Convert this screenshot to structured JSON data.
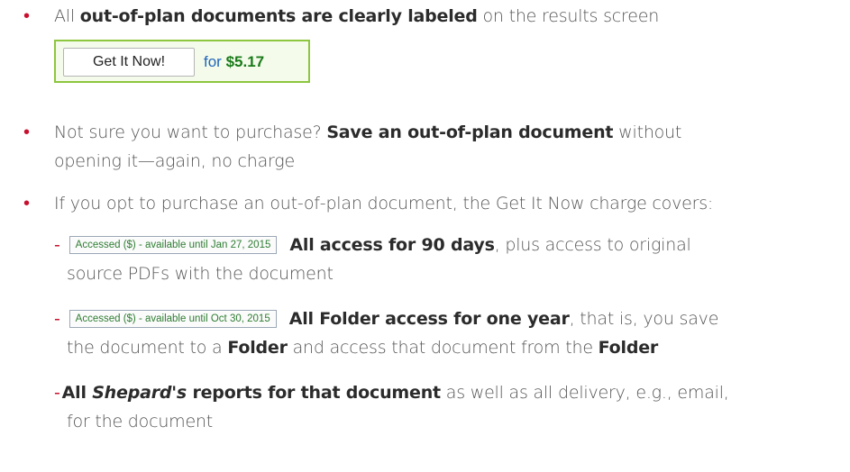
{
  "bullets": [
    {
      "pre": "All ",
      "bold": "out-of-plan documents are clearly labeled",
      "post": " on the results screen"
    },
    {
      "pre": "Not sure you want to purchase? ",
      "bold": "Save an out-of-plan document",
      "post": " without",
      "line2": "opening it—again, no charge"
    },
    {
      "text": "If you opt to purchase an out-of-plan document, the Get It Now charge covers:"
    }
  ],
  "get_it_now": {
    "button_label": "Get It Now!",
    "price_prefix": "for ",
    "price": "$5.17"
  },
  "sub_items": [
    {
      "dash": "-",
      "badge": "Accessed ($) - available until Jan 27, 2015",
      "bold": "All access for 90 days",
      "post": ", plus access to original",
      "line2": "source PDFs with the document"
    },
    {
      "dash": "-",
      "badge": "Accessed ($) - available until Oct 30, 2015",
      "bold": "All Folder access for one year",
      "post": ", that is, you save",
      "line2_pre": "the document to a ",
      "line2_bold1": "Folder",
      "line2_mid": " and access that document from the ",
      "line2_bold2": "Folder"
    },
    {
      "dash": "-",
      "bold_pre": "All ",
      "bold_italic": "Shepard's",
      "bold_post": " reports for that document",
      "post": " as well as all delivery, e.g., email,",
      "line2": "for the document"
    }
  ],
  "colors": {
    "bullet": "#c8102e",
    "emphasis": "#2b2b2b",
    "body": "#555555",
    "price_green": "#1a7a1a",
    "price_blue": "#2266bb",
    "box_border": "#8dc63f",
    "badge_text": "#2e7d32"
  }
}
